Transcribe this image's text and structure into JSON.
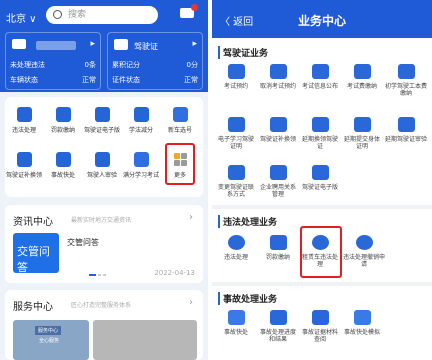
{
  "left": {
    "city": "北京 ∨",
    "search_placeholder": "搜索",
    "cards": [
      {
        "lines": [
          [
            "未处理违法",
            "0条"
          ],
          [
            "车辆状态",
            "正常"
          ]
        ]
      },
      {
        "title": "驾驶证",
        "lines": [
          [
            "累积记分",
            "0分"
          ],
          [
            "证件状态",
            "正常"
          ]
        ]
      }
    ],
    "grid": [
      "违法处理",
      "罚款缴纳",
      "驾驶证电子版",
      "学法减分",
      "新车选号",
      "驾驶证补换领",
      "事故快处",
      "驾驶人审验",
      "满分学习考试",
      "更多"
    ],
    "info": {
      "title": "资讯中心",
      "subtitle": "最新实时地方交通资讯",
      "banner": "交管问答",
      "banner_small": "交管问答",
      "news": "交管问答",
      "date": "2022-04-13"
    },
    "service": {
      "title": "服务中心",
      "subtitle": "匠心打造完整服务体系",
      "photo_tag": "服务中心",
      "photo_caption": "全心服务"
    }
  },
  "right": {
    "back": "〈 返回",
    "title": "业务中心",
    "sections": [
      {
        "title": "驾驶证业务",
        "items": [
          "考试预约",
          "取消考试预约",
          "考试信息公布",
          "考试费缴纳",
          "初学驾驶工本费缴纳",
          "电子学习驾驶证明",
          "驾驶证补换领",
          "延期换领驾驶证",
          "延期提交身体证明",
          "延期驾驶证审验",
          "变更驾驶证联系方式",
          "企业聘用关系管理",
          "驾驶证电子版"
        ]
      },
      {
        "title": "违法处理业务",
        "items": [
          "违法处理",
          "罚款缴纳",
          "租赁车违法处理",
          "违法处理撤销申请"
        ]
      },
      {
        "title": "事故处理业务",
        "items": [
          "事故快处",
          "事故处理进度和结果",
          "事故证据材料查阅",
          "事故快处模拟"
        ]
      }
    ]
  },
  "colors": {
    "brand": "#1f5bd6",
    "highlight": "#e02020"
  }
}
